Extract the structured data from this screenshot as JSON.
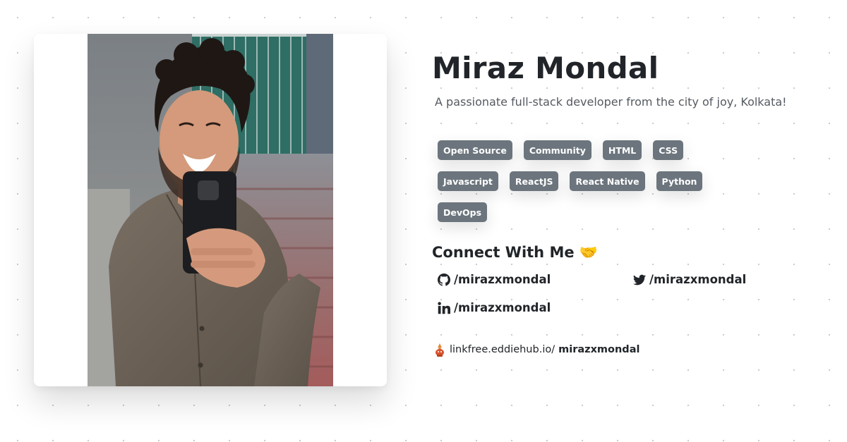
{
  "profile": {
    "name": "Miraz Mondal",
    "tagline": "A passionate full-stack developer from the city of joy, Kolkata!"
  },
  "tags": [
    [
      "Open Source",
      "Community",
      "HTML",
      "CSS"
    ],
    [
      "Javascript",
      "ReactJS",
      "React Native",
      "Python"
    ],
    [
      "DevOps"
    ]
  ],
  "connect": {
    "title": "Connect With Me 🤝",
    "links": [
      {
        "network": "github",
        "icon": "github-icon",
        "label": "/mirazxmondal"
      },
      {
        "network": "twitter",
        "icon": "twitter-icon",
        "label": "/mirazxmondal"
      },
      {
        "network": "linkedin",
        "icon": "linkedin-icon",
        "label": "/mirazxmondal"
      }
    ]
  },
  "linkfree": {
    "icon": "linkfree-logo-icon",
    "host": "linkfree.eddiehub.io/",
    "user": "mirazxmondal"
  },
  "colors": {
    "tag_bg": "#6c757d",
    "text": "#212529",
    "muted": "#555a60"
  }
}
